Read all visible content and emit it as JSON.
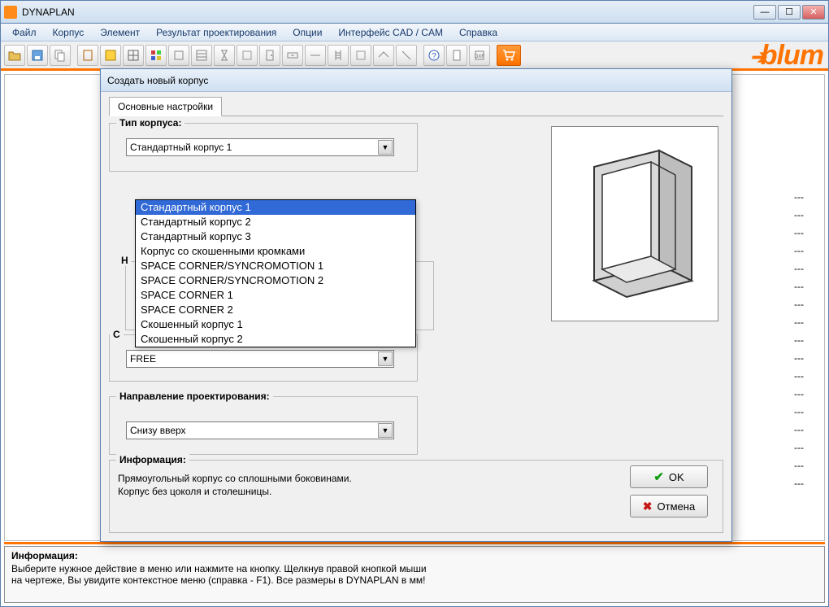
{
  "window": {
    "title": "DYNAPLAN"
  },
  "menu": {
    "file": "Файл",
    "korpus": "Корпус",
    "element": "Элемент",
    "result": "Результат проектирования",
    "options": "Опции",
    "cad": "Интерфейс CAD / CAM",
    "help": "Справка"
  },
  "brand": "blum",
  "side_dashes": [
    "---",
    "---",
    "---",
    "---",
    "---",
    "---",
    "---",
    "---",
    "---",
    "---",
    "---",
    "---",
    "---",
    "---",
    "---",
    "---",
    "---"
  ],
  "bottom_info": {
    "header": "Информация:",
    "line1": "Выберите нужное действие в меню или нажмите на кнопку. Щелкнув правой кнопкой мыши",
    "line2": "на чертеже, Вы увидите контекстное меню (справка - F1). Все размеры в DYNAPLAN в мм!"
  },
  "dialog": {
    "title": "Создать новый корпус",
    "tab": "Основные настройки",
    "group_type": "Тип корпуса:",
    "combo_type_value": "Стандартный корпус 1",
    "type_options": [
      "Стандартный корпус 1",
      "Стандартный корпус 2",
      "Стандартный корпус 3",
      "Корпус со скошенными кромками",
      "SPACE CORNER/SYNCROMOTION 1",
      "SPACE CORNER/SYNCROMOTION 2",
      "SPACE CORNER 1",
      "SPACE CORNER 2",
      "Скошенный корпус 1",
      "Скошенный корпус 2"
    ],
    "hidden_label_h": "Н",
    "hidden_label_c": "С",
    "combo_free": "FREE",
    "group_direction": "Направление проектирования:",
    "combo_direction_value": "Снизу вверх",
    "info_header": "Информация:",
    "info_line1": "Прямоугольный корпус со сплошными боковинами.",
    "info_line2": "Корпус без цоколя и столешницы.",
    "ok": "OK",
    "cancel": "Отмена"
  }
}
